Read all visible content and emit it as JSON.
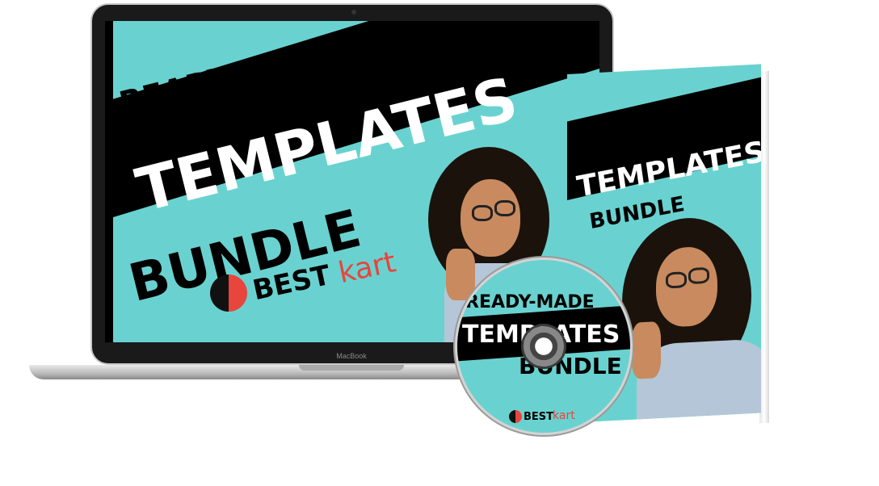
{
  "product": {
    "line1": "READY-MADE",
    "line2": "TEMPLATES",
    "line3": "BUNDLE",
    "brand_dark": "BEST",
    "brand_accent": "kart"
  },
  "device": {
    "laptop_label": "MacBook"
  },
  "colors": {
    "screen_bg": "#69d2d0",
    "band": "#000000",
    "brand_accent": "#e8453c",
    "sweater": "#b5c6d8"
  },
  "icons": {
    "logo": "bestkart-logo-icon",
    "thumb": "thumbs-up"
  }
}
